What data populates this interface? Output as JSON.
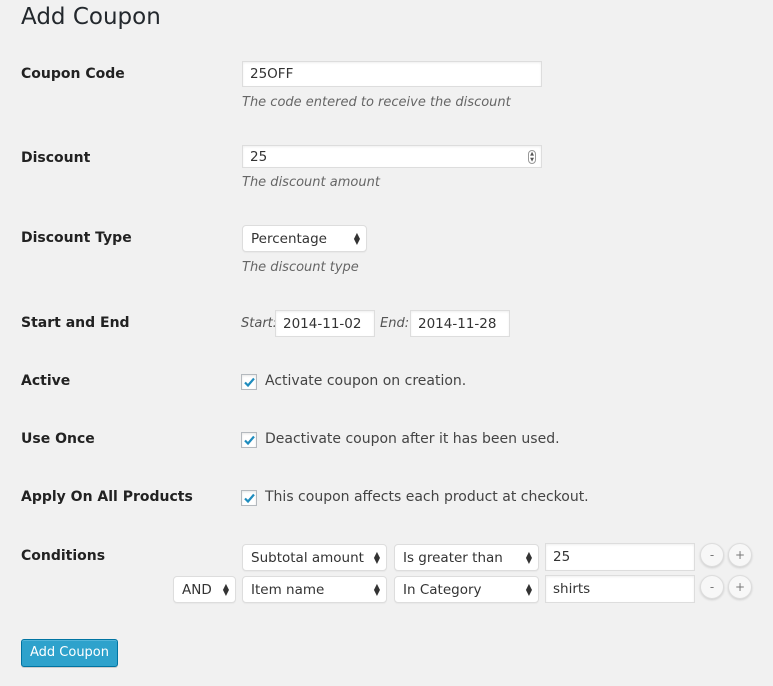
{
  "page": {
    "title": "Add Coupon"
  },
  "colors": {
    "background": "#f1f1f1",
    "primary": "#2ea2cc",
    "check": "#1e8cbe"
  },
  "fields": {
    "coupon_code": {
      "label": "Coupon Code",
      "value": "25OFF",
      "description": "The code entered to receive the discount"
    },
    "discount": {
      "label": "Discount",
      "value": "25",
      "description": "The discount amount"
    },
    "discount_type": {
      "label": "Discount Type",
      "selected": "Percentage",
      "description": "The discount type"
    },
    "dates": {
      "label": "Start and End",
      "start_label": "Start:",
      "start_value": "2014-11-02",
      "end_label": "End:",
      "end_value": "2014-11-28"
    },
    "active": {
      "label": "Active",
      "checked": true,
      "text": "Activate coupon on creation."
    },
    "use_once": {
      "label": "Use Once",
      "checked": true,
      "text": "Deactivate coupon after it has been used."
    },
    "apply_all": {
      "label": "Apply On All Products",
      "checked": true,
      "text": "This coupon affects each product at checkout."
    }
  },
  "conditions": {
    "label": "Conditions",
    "rows": [
      {
        "field": "Subtotal amount",
        "operator": "Is greater than",
        "value": "25",
        "remove": "-",
        "add": "+"
      },
      {
        "logic": "AND",
        "field": "Item name",
        "operator": "In Category",
        "value": "shirts",
        "remove": "-",
        "add": "+"
      }
    ]
  },
  "submit": {
    "label": "Add Coupon"
  }
}
